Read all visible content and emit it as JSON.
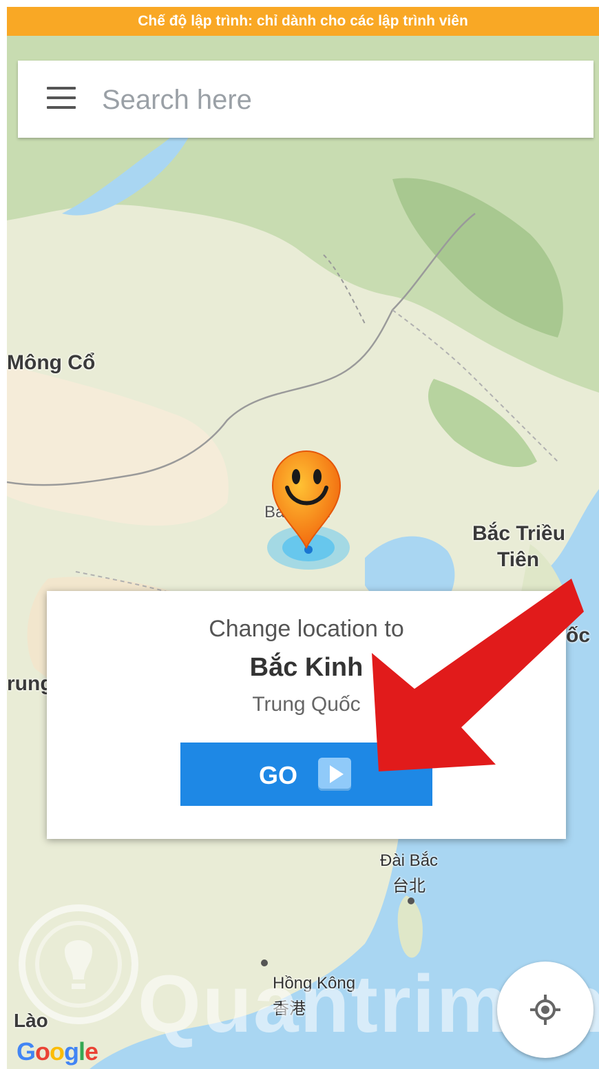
{
  "status_banner": {
    "text": "Chế độ lập trình: chỉ dành cho các lập trình viên",
    "color": "#f9a825"
  },
  "search": {
    "placeholder": "Search here",
    "menu_icon": "hamburger-menu-icon"
  },
  "map": {
    "labels": {
      "mongolia": "Mông Cổ",
      "beijing": "Bắc Kinh",
      "north_korea_line1": "Bắc Triều",
      "north_korea_line2": "Tiên",
      "korea_partial": "ốc",
      "china_partial": "rung",
      "taipei": "Đài Bắc",
      "taipei_cn": "台北",
      "hongkong": "Hồng Kông",
      "hongkong_cn": "香港",
      "laos": "Lào"
    },
    "pin_icon": "smiley-location-pin-icon"
  },
  "dialog": {
    "title": "Change location to",
    "city": "Bắc Kinh",
    "country": "Trung Quốc",
    "go_label": "GO",
    "go_icon": "play-icon",
    "button_color": "#1e88e5"
  },
  "watermark": {
    "text": "Quantrimang",
    "icon": "lightbulb-icon"
  },
  "attribution": {
    "google_letters": [
      "G",
      "o",
      "o",
      "g",
      "l",
      "e"
    ]
  },
  "locate_button": {
    "icon": "my-location-icon"
  },
  "annotation_arrow": {
    "color": "#e11b1b",
    "icon": "red-arrow-icon"
  }
}
